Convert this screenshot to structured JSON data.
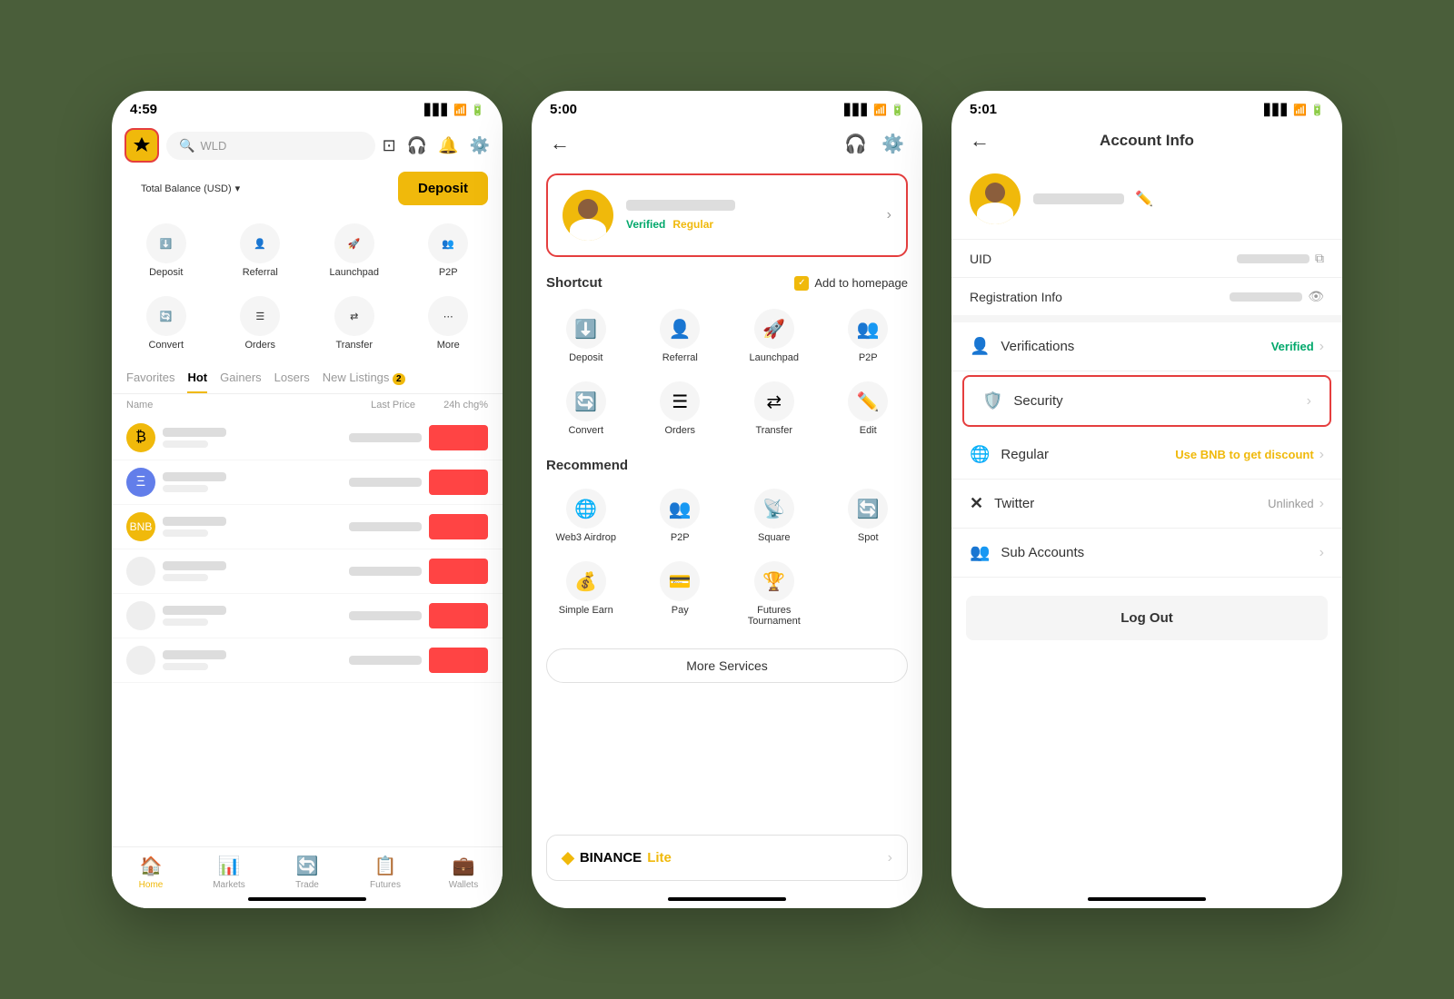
{
  "screen1": {
    "status_time": "4:59",
    "logo_emoji": "◆",
    "search_placeholder": "WLD",
    "balance_label": "Total Balance (USD)",
    "balance_arrow": "▾",
    "deposit_btn": "Deposit",
    "shortcuts": [
      {
        "label": "Deposit",
        "icon": "⬇️"
      },
      {
        "label": "Referral",
        "icon": "👤"
      },
      {
        "label": "Launchpad",
        "icon": "🚀"
      },
      {
        "label": "P2P",
        "icon": "👥"
      },
      {
        "label": "Convert",
        "icon": "🔄"
      },
      {
        "label": "Orders",
        "icon": "☰"
      },
      {
        "label": "Transfer",
        "icon": "⇄"
      },
      {
        "label": "More",
        "icon": "⋯"
      }
    ],
    "tabs": [
      "Favorites",
      "Hot",
      "Gainers",
      "Losers",
      "New Listings"
    ],
    "active_tab": "Hot",
    "new_listings_count": "2",
    "list_header": {
      "col1": "Name",
      "col2": "Last Price",
      "col3": "24h chg%"
    },
    "nav_items": [
      {
        "label": "Home",
        "icon": "🏠",
        "active": true
      },
      {
        "label": "Markets",
        "icon": "📊"
      },
      {
        "label": "Trade",
        "icon": "🔄"
      },
      {
        "label": "Futures",
        "icon": "📋"
      },
      {
        "label": "Wallets",
        "icon": "💼"
      }
    ]
  },
  "screen2": {
    "status_time": "5:00",
    "profile": {
      "verified_label": "Verified",
      "regular_label": "Regular"
    },
    "shortcut_title": "Shortcut",
    "add_to_homepage": "Add to homepage",
    "shortcuts": [
      {
        "label": "Deposit",
        "icon": "⬇️"
      },
      {
        "label": "Referral",
        "icon": "👤"
      },
      {
        "label": "Launchpad",
        "icon": "🚀"
      },
      {
        "label": "P2P",
        "icon": "👥"
      },
      {
        "label": "Convert",
        "icon": "🔄"
      },
      {
        "label": "Orders",
        "icon": "☰"
      },
      {
        "label": "Transfer",
        "icon": "⇄"
      },
      {
        "label": "Edit",
        "icon": "✏️"
      }
    ],
    "recommend_title": "Recommend",
    "recommend": [
      {
        "label": "Web3 Airdrop",
        "icon": "🌐"
      },
      {
        "label": "P2P",
        "icon": "👥"
      },
      {
        "label": "Square",
        "icon": "📡"
      },
      {
        "label": "Spot",
        "icon": "🔄"
      },
      {
        "label": "Simple Earn",
        "icon": "💰"
      },
      {
        "label": "Pay",
        "icon": "💳"
      },
      {
        "label": "Futures Tournament",
        "icon": "🏆"
      }
    ],
    "more_services": "More Services",
    "binance_logo": "BINANCE",
    "binance_lite": "Lite"
  },
  "screen3": {
    "status_time": "5:01",
    "title": "Account Info",
    "uid_label": "UID",
    "registration_label": "Registration Info",
    "menu_items": [
      {
        "icon": "👤",
        "label": "Verifications",
        "value": "Verified",
        "value_type": "verified"
      },
      {
        "icon": "🛡️",
        "label": "Security",
        "value": "",
        "value_type": "none",
        "highlighted": true
      },
      {
        "icon": "🌐",
        "label": "Regular",
        "value": "Use BNB to get discount",
        "value_type": "bnb"
      },
      {
        "icon": "✕",
        "label": "Twitter",
        "value": "Unlinked",
        "value_type": "unlinked"
      },
      {
        "icon": "👥",
        "label": "Sub Accounts",
        "value": "",
        "value_type": "none"
      }
    ],
    "logout_btn": "Log Out"
  }
}
